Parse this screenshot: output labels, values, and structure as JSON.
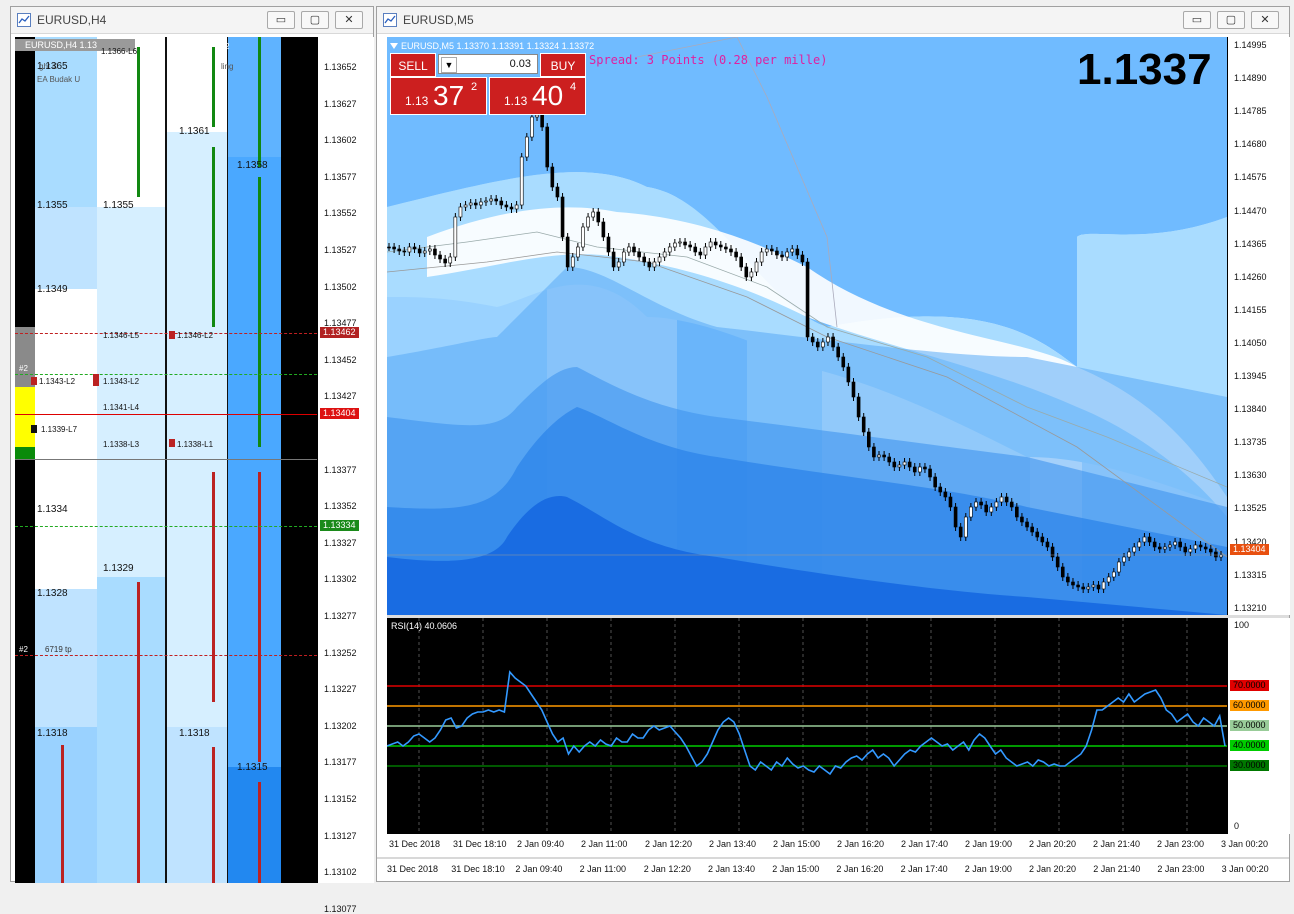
{
  "left_window": {
    "title": "EURUSD,H4",
    "header_strip": "EURUSD,H4 1.13",
    "overlay_texts": [
      "1.1366-L6",
      "ght ©",
      "ling",
      "EA Budak U",
      "2"
    ],
    "price_axis": [
      "1.13652",
      "1.13627",
      "1.13602",
      "1.13577",
      "1.13552",
      "1.13527",
      "1.13502",
      "1.13477",
      "1.13452",
      "1.13427",
      "1.13377",
      "1.13352",
      "1.13327",
      "1.13302",
      "1.13277",
      "1.13252",
      "1.13227",
      "1.13202",
      "1.13177",
      "1.13152",
      "1.13127",
      "1.13102",
      "1.13077"
    ],
    "price_tag_red": "1.13462",
    "price_tag_current": "1.13404",
    "price_tag_green": "1.13334",
    "levels_col1": [
      "1.1365",
      "1.1355",
      "1.1349",
      "1.1334",
      "1.1328",
      "1.1318"
    ],
    "levels_col2": [
      "1.1355",
      "1.1329"
    ],
    "levels_col3": [
      "1.1361",
      "1.1318"
    ],
    "levels_col4": [
      "1.1358",
      "1.1315"
    ],
    "line_labels": [
      "1.1346-L5",
      "1.1346-L2",
      "1.1343-L2",
      "1.1343-L2",
      "1.1341-L4",
      "1.1339-L7",
      "1.1338-L3",
      "1.1338-L1"
    ],
    "order_label_1": "#2",
    "order_label_2": "#2",
    "order_tp": "6719 tp"
  },
  "right_window": {
    "title": "EURUSD,M5",
    "header_strip": "EURUSD,M5  1.13370 1.13391 1.13324 1.13372",
    "spread_text": "Spread: 3 Points (0.28 per mille)",
    "big_price": "1.1337",
    "trade_panel": {
      "sell_label": "SELL",
      "buy_label": "BUY",
      "lot_value": "0.03",
      "sell_prefix": "1.13",
      "sell_big": "37",
      "sell_sup": "2",
      "buy_prefix": "1.13",
      "buy_big": "40",
      "buy_sup": "4"
    },
    "price_axis": [
      "1.14995",
      "1.14890",
      "1.14785",
      "1.14680",
      "1.14575",
      "1.14470",
      "1.14365",
      "1.14260",
      "1.14155",
      "1.14050",
      "1.13945",
      "1.13840",
      "1.13735",
      "1.13630",
      "1.13525",
      "1.13420",
      "1.13315",
      "1.13210"
    ],
    "price_tag_current": "1.13404",
    "rsi": {
      "label": "RSI(14) 40.0606",
      "scale_top": "100",
      "scale_bottom": "0",
      "levels": [
        {
          "value": "70.0000",
          "color": "#e00000"
        },
        {
          "value": "60.0000",
          "color": "#ff9900"
        },
        {
          "value": "50.0000",
          "color": "#99cc99"
        },
        {
          "value": "40.0000",
          "color": "#00cc00"
        },
        {
          "value": "30.0000",
          "color": "#007700"
        }
      ]
    },
    "time_axis": [
      "31 Dec 2018",
      "31 Dec 18:10",
      "2 Jan 09:40",
      "2 Jan 11:00",
      "2 Jan 12:20",
      "2 Jan 13:40",
      "2 Jan 15:00",
      "2 Jan 16:20",
      "2 Jan 17:40",
      "2 Jan 19:00",
      "2 Jan 20:20",
      "2 Jan 21:40",
      "2 Jan 23:00",
      "3 Jan 00:20"
    ]
  },
  "bottom_time_axis": [
    "31 Dec 2018",
    "31 Dec 18:10",
    "2 Jan 09:40",
    "2 Jan 11:00",
    "2 Jan 12:20",
    "2 Jan 13:40",
    "2 Jan 15:00",
    "2 Jan 16:20",
    "2 Jan 17:40",
    "2 Jan 19:00",
    "2 Jan 20:20",
    "2 Jan 21:40",
    "2 Jan 23:00",
    "3 Jan 00:20"
  ],
  "window_buttons": {
    "minimize": "▭",
    "maximize": "▢",
    "close": "✕"
  }
}
